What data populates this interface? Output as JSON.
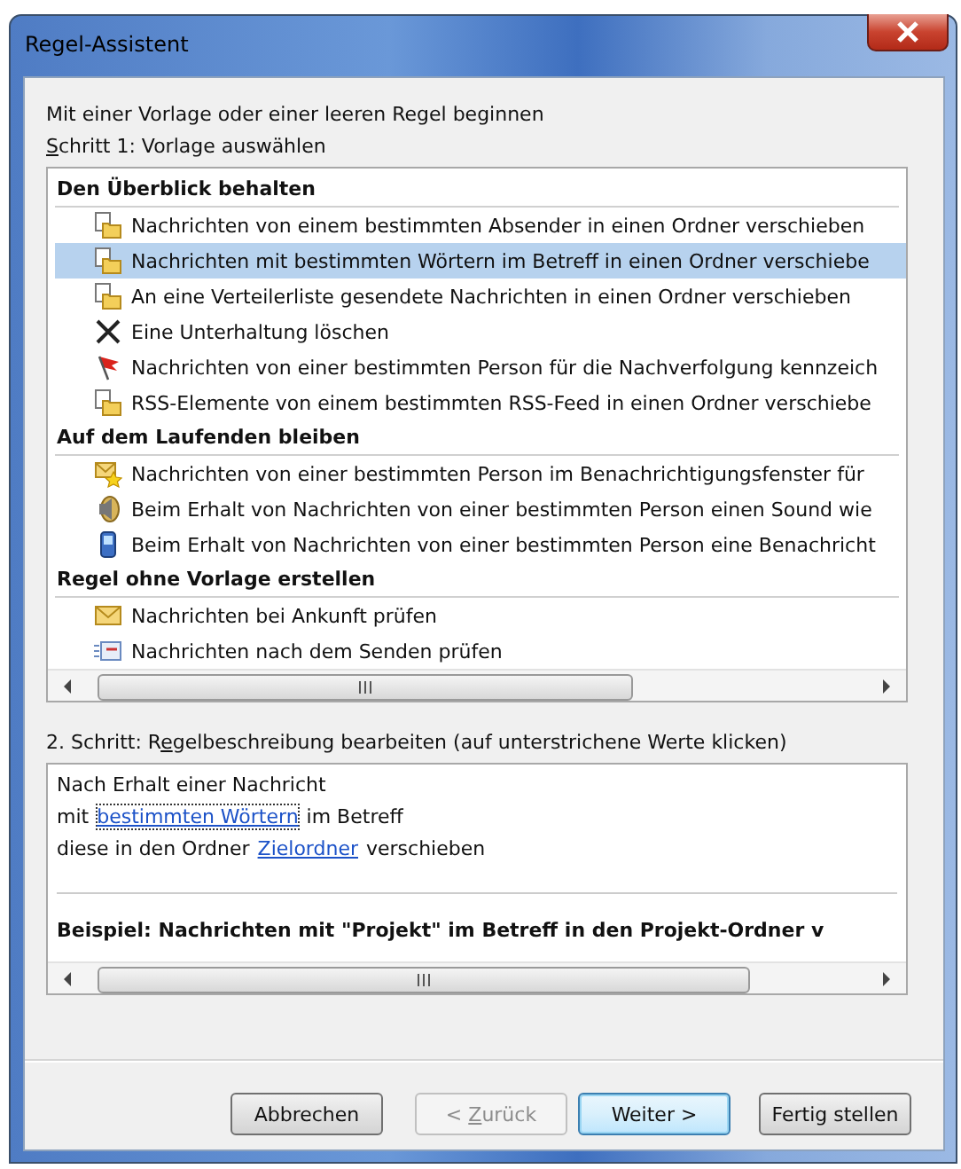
{
  "window": {
    "title": "Regel-Assistent"
  },
  "intro": "Mit einer Vorlage oder einer leeren Regel beginnen",
  "step1_label": {
    "key": "S",
    "after": "chritt 1: Vorlage auswählen"
  },
  "rule_groups": [
    {
      "title": "Den Überblick behalten",
      "items": [
        {
          "kind": "folder",
          "text": "Nachrichten von einem bestimmten Absender in einen Ordner verschieben",
          "selected": false
        },
        {
          "kind": "folder",
          "text": "Nachrichten mit bestimmten Wörtern im Betreff in einen Ordner verschiebe",
          "selected": true
        },
        {
          "kind": "folder",
          "text": "An eine Verteilerliste gesendete Nachrichten in einen Ordner verschieben",
          "selected": false
        },
        {
          "kind": "delete",
          "text": "Eine Unterhaltung löschen",
          "selected": false
        },
        {
          "kind": "flag",
          "text": "Nachrichten von einer bestimmten Person für die Nachverfolgung kennzeich",
          "selected": false
        },
        {
          "kind": "folder",
          "text": "RSS-Elemente von einem bestimmten RSS-Feed in einen Ordner verschiebe",
          "selected": false
        }
      ]
    },
    {
      "title": "Auf dem Laufenden bleiben",
      "items": [
        {
          "kind": "star-mail",
          "text": "Nachrichten von einer bestimmten Person im Benachrichtigungsfenster für",
          "selected": false
        },
        {
          "kind": "speaker",
          "text": "Beim Erhalt von Nachrichten von einer bestimmten Person einen Sound wie",
          "selected": false
        },
        {
          "kind": "phone",
          "text": "Beim Erhalt von Nachrichten von einer bestimmten Person eine Benachricht",
          "selected": false
        }
      ]
    },
    {
      "title": "Regel ohne Vorlage erstellen",
      "items": [
        {
          "kind": "mail",
          "text": "Nachrichten bei Ankunft prüfen",
          "selected": false
        },
        {
          "kind": "sent-mail",
          "text": "Nachrichten nach dem Senden prüfen",
          "selected": false
        }
      ]
    }
  ],
  "step2_label": {
    "before": "2. Schritt: R",
    "key": "e",
    "after": "gelbeschreibung bearbeiten (auf unterstrichene Werte klicken)"
  },
  "description": {
    "lines": [
      [
        {
          "text": "Nach Erhalt einer Nachricht",
          "link": false
        }
      ],
      [
        {
          "text": "mit ",
          "link": false
        },
        {
          "text": "bestimmten Wörtern",
          "link": true,
          "focused": true
        },
        {
          "text": " im Betreff",
          "link": false
        }
      ],
      [
        {
          "text": "diese in den Ordner ",
          "link": false
        },
        {
          "text": "Zielordner",
          "link": true,
          "focused": false
        },
        {
          "text": " verschieben",
          "link": false
        }
      ]
    ],
    "example": "Beispiel: Nachrichten mit \"Projekt\" im Betreff in den Projekt-Ordner v"
  },
  "buttons": [
    {
      "label": {
        "before": "Abbrechen"
      },
      "disabled": false,
      "default": false
    },
    {
      "label": {
        "before": "< ",
        "key": "Z",
        "after": "urück"
      },
      "disabled": true,
      "default": false
    },
    {
      "label": {
        "before": "Weiter >"
      },
      "disabled": false,
      "default": true
    },
    {
      "label": {
        "before": "Fertig stellen"
      },
      "disabled": false,
      "default": false
    }
  ]
}
